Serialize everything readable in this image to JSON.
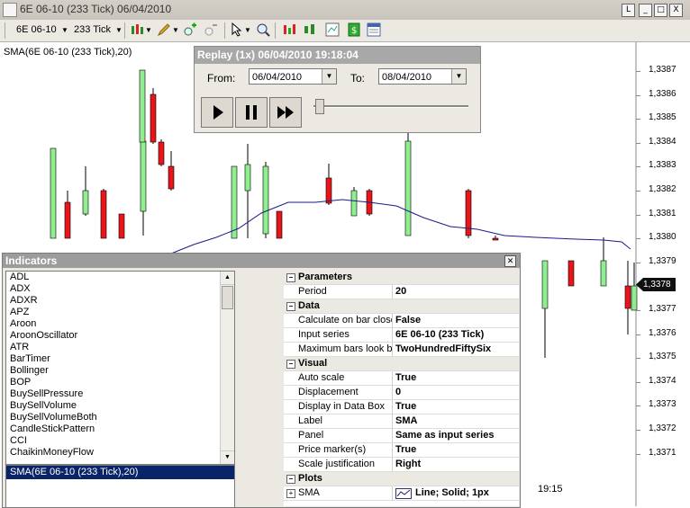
{
  "window": {
    "title": "6E 06-10 (233 Tick)  06/04/2010",
    "buttons": [
      "L",
      "_",
      "□",
      "X"
    ]
  },
  "toolbar": {
    "instrument": "6E 06-10",
    "interval": "233 Tick"
  },
  "chart": {
    "series_label": "SMA(6E 06-10 (233 Tick),20)",
    "price_labels": [
      "1,3387",
      "1,3386",
      "1,3385",
      "1,3384",
      "1,3383",
      "1,3382",
      "1,3381",
      "1,3380",
      "1,3379",
      "1,3378",
      "1,3377",
      "1,3376",
      "1,3375",
      "1,3374",
      "1,3373",
      "1,3372",
      "1,3371"
    ],
    "current_price": "1,3378",
    "time_label": "19:15"
  },
  "replay": {
    "title": "Replay (1x) 06/04/2010 19:18:04",
    "from_label": "From:",
    "from_value": "06/04/2010",
    "to_label": "To:",
    "to_value": "08/04/2010"
  },
  "indicators": {
    "title": "Indicators",
    "list": [
      "ADL",
      "ADX",
      "ADXR",
      "APZ",
      "Aroon",
      "AroonOscillator",
      "ATR",
      "BarTimer",
      "Bollinger",
      "BOP",
      "BuySellPressure",
      "BuySellVolume",
      "BuySellVolumeBoth",
      "CandleStickPattern",
      "CCI",
      "ChaikinMoneyFlow"
    ],
    "applied": [
      "SMA(6E 06-10 (233 Tick),20)"
    ],
    "properties": [
      {
        "type": "cat",
        "name": "Parameters"
      },
      {
        "type": "row",
        "name": "Period",
        "value": "20"
      },
      {
        "type": "cat",
        "name": "Data"
      },
      {
        "type": "row",
        "name": "Calculate on bar close",
        "value": "False"
      },
      {
        "type": "row",
        "name": "Input series",
        "value": "6E 06-10 (233 Tick)"
      },
      {
        "type": "row",
        "name": "Maximum bars look back",
        "value": "TwoHundredFiftySix"
      },
      {
        "type": "cat",
        "name": "Visual"
      },
      {
        "type": "row",
        "name": "Auto scale",
        "value": "True"
      },
      {
        "type": "row",
        "name": "Displacement",
        "value": "0"
      },
      {
        "type": "row",
        "name": "Display in Data Box",
        "value": "True"
      },
      {
        "type": "row",
        "name": "Label",
        "value": "SMA"
      },
      {
        "type": "row",
        "name": "Panel",
        "value": "Same as input series"
      },
      {
        "type": "row",
        "name": "Price marker(s)",
        "value": "True"
      },
      {
        "type": "row",
        "name": "Scale justification",
        "value": "Right"
      },
      {
        "type": "cat",
        "name": "Plots"
      },
      {
        "type": "plot",
        "name": "SMA",
        "value": "Line; Solid; 1px"
      }
    ]
  },
  "colors": {
    "up_candle": "#90ee90",
    "down_candle": "#e8161b",
    "sma_line": "#1a1a8c",
    "selection": "#0a246a"
  }
}
